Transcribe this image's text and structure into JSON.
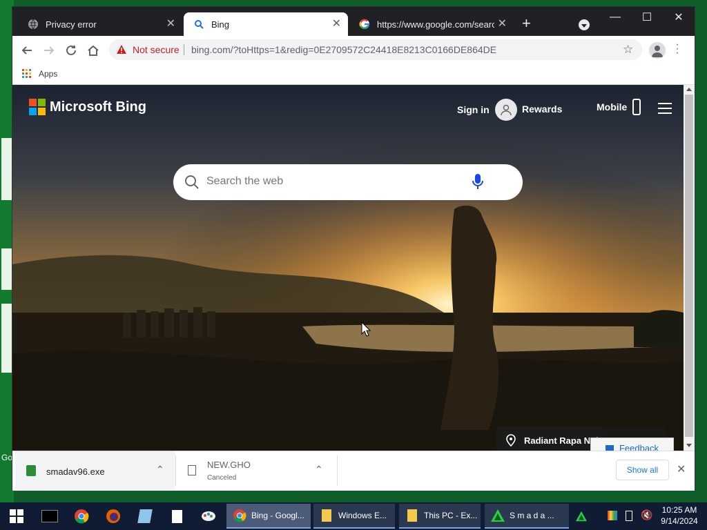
{
  "tabs": [
    {
      "label": "Privacy error",
      "icon": "globe-icon"
    },
    {
      "label": "Bing",
      "icon": "search-icon"
    },
    {
      "label": "https://www.google.com/search?",
      "icon": "google-icon"
    }
  ],
  "toolbar": {
    "security_label": "Not secure",
    "url": "bing.com/?toHttps=1&redig=0E2709572C24418E8213C0166DE864DE"
  },
  "bookmarks": {
    "apps_label": "Apps"
  },
  "bing": {
    "logo": "Microsoft Bing",
    "sign_in": "Sign in",
    "rewards": "Rewards",
    "mobile": "Mobile",
    "search_placeholder": "Search the web",
    "location": "Radiant Rapa Nui",
    "feedback": "Feedback"
  },
  "downloads": {
    "items": [
      {
        "name": "smadav96.exe",
        "status": ""
      },
      {
        "name": "NEW.GHO",
        "status": "Canceled"
      }
    ],
    "show_all": "Show all"
  },
  "taskbar": {
    "apps": [
      {
        "label": "Bing - Googl..."
      },
      {
        "label": "Windows E..."
      },
      {
        "label": "This PC - Ex..."
      },
      {
        "label": "S m a d a ..."
      }
    ],
    "time": "10:25 AM",
    "date": "9/14/2024"
  },
  "colors": {
    "tabbar": "#202124",
    "taskbar": "#101c34",
    "warning": "#c5221f",
    "feedback": "#1b6ac9"
  }
}
